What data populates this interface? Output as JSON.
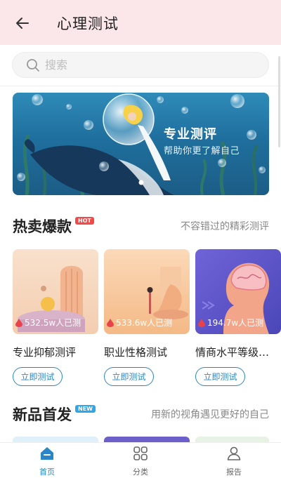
{
  "header": {
    "title": "心理测试",
    "back_icon": "arrow-left-icon"
  },
  "search": {
    "placeholder": "搜索"
  },
  "banner": {
    "title": "专业测评",
    "subtitle": "帮助你更了解自己"
  },
  "hot_section": {
    "title": "热卖爆款",
    "badge": "HOT",
    "more": "不容错过的精彩测评"
  },
  "hot_cards": [
    {
      "name": "专业抑郁测评",
      "count": "532.5w人已测",
      "button": "立即测试"
    },
    {
      "name": "职业性格测试",
      "count": "533.6w人已测",
      "button": "立即测试"
    },
    {
      "name": "情商水平等级测试",
      "count": "194.7w人已测",
      "button": "立即测试"
    }
  ],
  "new_section": {
    "title": "新品首发",
    "badge": "NEW",
    "more": "用新的视角遇见更好的自己"
  },
  "tabbar": [
    {
      "label": "首页",
      "icon": "home-icon",
      "active": true
    },
    {
      "label": "分类",
      "icon": "grid-icon",
      "active": false
    },
    {
      "label": "报告",
      "icon": "user-icon",
      "active": false
    }
  ],
  "colors": {
    "accent": "#2a86c7",
    "hot_badge": "#f04a4a",
    "new_badge": "#2ea6e8",
    "header_bg": "#fbe6e9"
  }
}
